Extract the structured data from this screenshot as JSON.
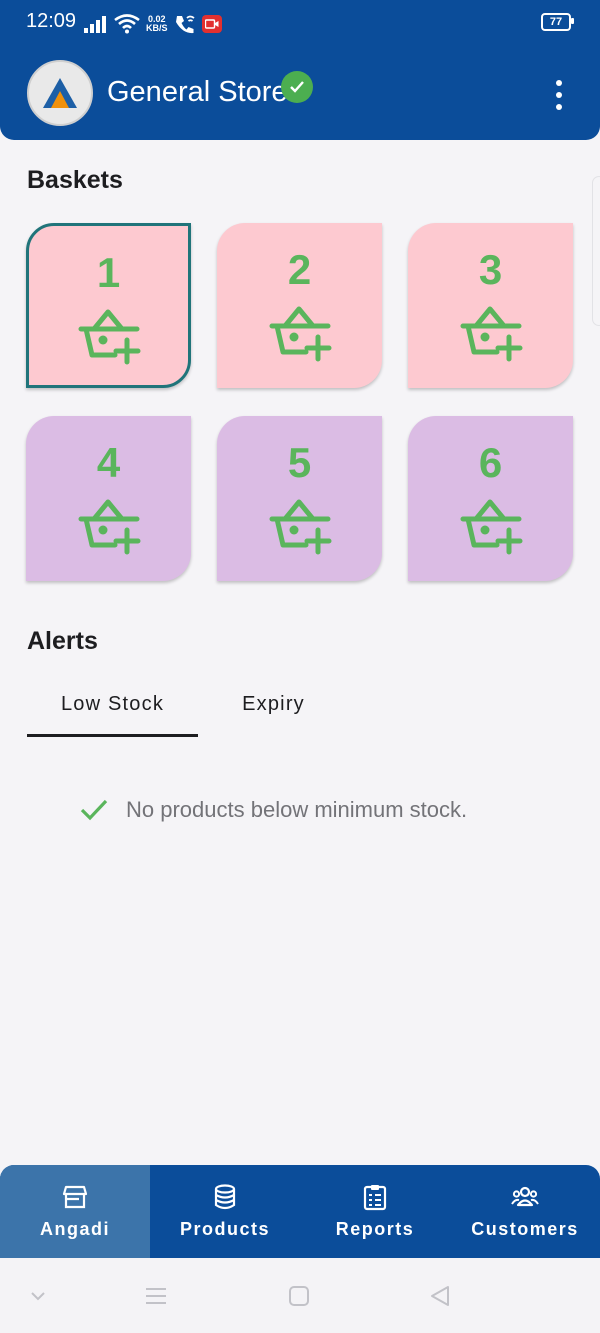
{
  "status_bar": {
    "time": "12:09",
    "speed_value": "0.02",
    "speed_unit": "KB/S",
    "battery": "77"
  },
  "app_bar": {
    "title": "General Store",
    "verified": true,
    "icons": {
      "avatar": "store-logo-icon",
      "verified": "check-badge-icon",
      "menu": "more-vertical-icon"
    }
  },
  "baskets_section": {
    "title": "Baskets",
    "items": [
      {
        "number": "1",
        "color": "#fdc9d0",
        "selected": true,
        "icon": "basket-add-icon"
      },
      {
        "number": "2",
        "color": "#fdc9d0",
        "selected": false,
        "icon": "basket-add-icon"
      },
      {
        "number": "3",
        "color": "#fdc9d0",
        "selected": false,
        "icon": "basket-add-icon"
      },
      {
        "number": "4",
        "color": "#dbbce4",
        "selected": false,
        "icon": "basket-add-icon"
      },
      {
        "number": "5",
        "color": "#dbbce4",
        "selected": false,
        "icon": "basket-add-icon"
      },
      {
        "number": "6",
        "color": "#dbbce4",
        "selected": false,
        "icon": "basket-add-icon"
      }
    ]
  },
  "alerts_section": {
    "title": "Alerts",
    "tabs": [
      {
        "label": "Low Stock",
        "active": true
      },
      {
        "label": "Expiry",
        "active": false
      }
    ],
    "empty_message": "No products below minimum stock.",
    "empty_icon": "check-icon"
  },
  "bottom_nav": {
    "items": [
      {
        "label": "Angadi",
        "icon": "storefront-icon",
        "active": true
      },
      {
        "label": "Products",
        "icon": "database-icon",
        "active": false
      },
      {
        "label": "Reports",
        "icon": "clipboard-list-icon",
        "active": false
      },
      {
        "label": "Customers",
        "icon": "people-icon",
        "active": false
      }
    ]
  },
  "colors": {
    "primary": "#0b4d9a",
    "nav_active": "#3c74aa",
    "accent_green": "#5ab55c",
    "selected_border": "#20747a",
    "background": "#f5f4f7"
  }
}
